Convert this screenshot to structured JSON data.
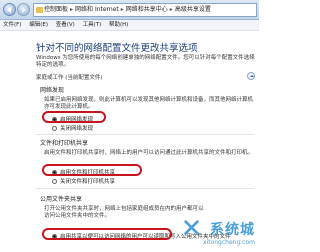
{
  "address": {
    "crumbs": [
      "控制面板",
      "网络和 Internet",
      "网络和共享中心",
      "高级共享设置"
    ],
    "separator": "▸"
  },
  "menu": [
    "文件(F)",
    "编辑(E)",
    "查看(V)",
    "工具(T)",
    "帮助(H)"
  ],
  "page": {
    "title": "针对不同的网络配置文件更改共享选项",
    "description": "Windows 为您所使用的每个网络创建单独的网络配置文件。您可以针对每个配置文件选择特定的选项。",
    "profile_label": "家庭或工作 (当前配置文件)"
  },
  "network_discovery": {
    "title": "网络发现",
    "description": "如果已启用网络发现，则此计算机可以发现其他网络计算机和设备，而其他网络计算机亦可发现此计算机。",
    "options": [
      "启用网络发现",
      "关闭网络发现"
    ],
    "selected": 0
  },
  "file_printer_sharing": {
    "title": "文件和打印机共享",
    "description": "启用文件和打印机共享时，网络上的用户可以访问通过此计算机共享的文件和打印机。",
    "options": [
      "启用文件和打印机共享",
      "关闭文件和打印机共享"
    ],
    "selected": 0
  },
  "public_folder_sharing": {
    "title": "公用文件夹共享",
    "description": "打开公用文件夹共享时，网络上包括家庭组成员在内的用户都可以访问公用文件夹中的文件。",
    "options": [
      "启用共享以便可以访问网络的用户可以读取和写入公用文件夹中的文件"
    ],
    "selected": 0
  },
  "watermark": {
    "logo": "系统城",
    "url": "xitongcheng.com"
  },
  "colors": {
    "highlight": "#c8141e",
    "title": "#1e3c78",
    "watermark": "#2a8fd0"
  }
}
